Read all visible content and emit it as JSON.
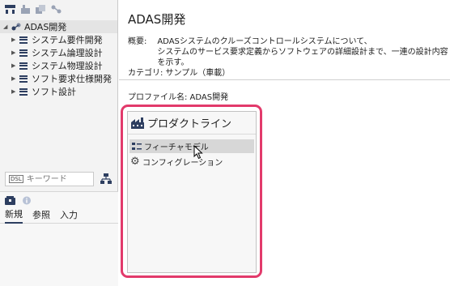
{
  "sidebar": {
    "toolbar_icons": [
      "hierarchy-icon",
      "build-icon",
      "copy-icon",
      "link-icon"
    ],
    "tree": {
      "root": {
        "label": "ADAS開発",
        "expanded": true
      },
      "children": [
        {
          "label": "システム要件開発"
        },
        {
          "label": "システム論理設計"
        },
        {
          "label": "システム物理設計"
        },
        {
          "label": "ソフト要求仕様開発"
        },
        {
          "label": "ソフト設計"
        }
      ]
    },
    "search": {
      "tag": "DSL",
      "placeholder": "キーワード"
    },
    "bottom_tabs": [
      {
        "label": "新規",
        "active": true
      },
      {
        "label": "参照",
        "active": false
      },
      {
        "label": "入力",
        "active": false
      }
    ]
  },
  "main": {
    "title": "ADAS開発",
    "summary_label": "概要:",
    "summary_lines": [
      "ADASシステムのクルーズコントロールシステムについて、",
      "システムのサービス要求定義からソフトウェアの詳細設計まで、一連の設計内容を示す。"
    ],
    "category": "カテゴリ: サンプル（車載）",
    "profile": "プロファイル名: ADAS開発",
    "panel": {
      "heading": "プロダクトライン",
      "items": [
        {
          "label": "フィーチャモデル",
          "hovered": true
        },
        {
          "label": "コンフィグレーション",
          "hovered": false
        }
      ]
    }
  },
  "colors": {
    "highlight": "#e23a6b",
    "icon_navy": "#2d3e60"
  }
}
